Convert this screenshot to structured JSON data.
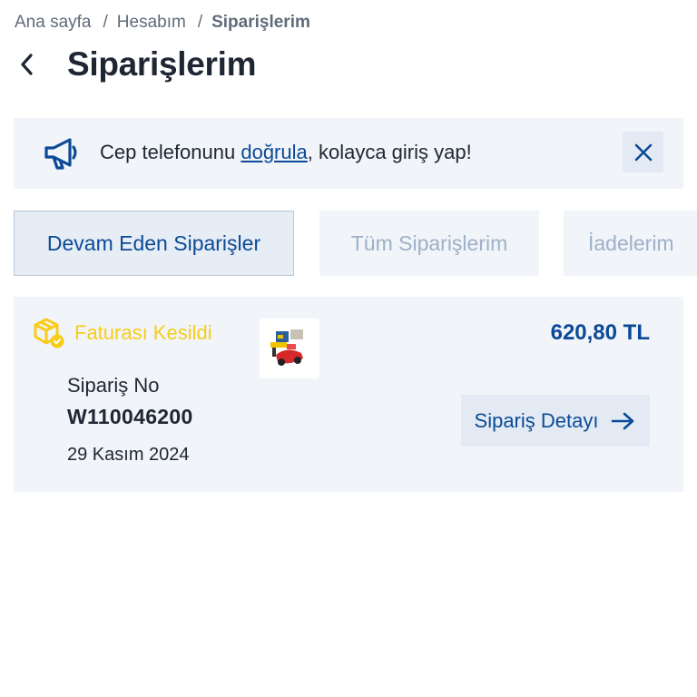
{
  "breadcrumb": {
    "items": [
      {
        "label": "Ana sayfa"
      },
      {
        "label": "Hesabım"
      },
      {
        "label": "Siparişlerim"
      }
    ],
    "separator": "/"
  },
  "header": {
    "title": "Siparişlerim",
    "back_icon": "chevron-left-icon"
  },
  "banner": {
    "icon": "megaphone-icon",
    "text_before": "Cep telefonunu ",
    "link_text": "doğrula",
    "text_after": ", kolayca giriş yap!",
    "close_icon": "close-icon"
  },
  "tabs": [
    {
      "label": "Devam Eden Siparişler",
      "active": true
    },
    {
      "label": "Tüm Siparişlerim",
      "active": false
    },
    {
      "label": "İadelerim",
      "active": false
    }
  ],
  "order": {
    "status_icon": "package-check-icon",
    "status": "Faturası Kesildi",
    "price": "620,80 TL",
    "order_no_label": "Sipariş No",
    "order_no": "W110046200",
    "date": "29 Kasım 2024",
    "detail_button": "Sipariş Detayı",
    "detail_icon": "arrow-right-icon"
  },
  "colors": {
    "primary": "#0b4a96",
    "status_yellow": "#f7cd1a",
    "panel_bg": "#f1f4f9",
    "text": "#1f2733",
    "muted_tab": "#9db1c8"
  }
}
